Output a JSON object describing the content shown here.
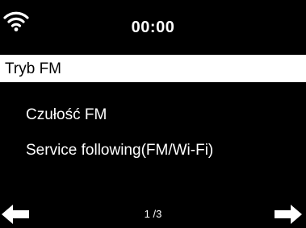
{
  "status": {
    "wifi_icon": "wifi-icon",
    "time": "00:00"
  },
  "title": {
    "text": "Tryb FM"
  },
  "menu": {
    "items": [
      {
        "label": "Czułość FM"
      },
      {
        "label": "Service following(FM/Wi-Fi)"
      }
    ]
  },
  "footer": {
    "page": "1 /3",
    "left_icon": "arrow-left-icon",
    "right_icon": "arrow-right-icon"
  },
  "colors": {
    "background": "#000000",
    "foreground": "#ffffff",
    "highlight_bg": "#ffffff",
    "highlight_fg": "#000000"
  }
}
